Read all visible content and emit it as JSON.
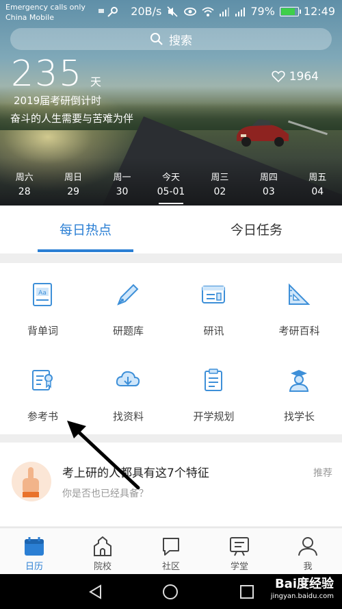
{
  "status_bar": {
    "carrier_line1": "Emergency calls only",
    "carrier_line2": "China Mobile",
    "speed": "20B/s",
    "battery": "79%",
    "battery_level": 0.79,
    "time": "12:49"
  },
  "search": {
    "label": "搜索"
  },
  "countdown": {
    "days": "235",
    "unit": "天",
    "likes": "1964",
    "subtitle": "2019届考研倒计时",
    "motto": "奋斗的人生需要与苦难为伴"
  },
  "week": [
    {
      "dow": "周六",
      "date": "28"
    },
    {
      "dow": "周日",
      "date": "29"
    },
    {
      "dow": "周一",
      "date": "30"
    },
    {
      "dow": "今天",
      "date": "05-01"
    },
    {
      "dow": "周三",
      "date": "02"
    },
    {
      "dow": "周四",
      "date": "03"
    },
    {
      "dow": "周五",
      "date": "04"
    }
  ],
  "tabs": [
    {
      "label": "每日热点"
    },
    {
      "label": "今日任务"
    }
  ],
  "grid": [
    {
      "label": "背单词",
      "icon": "dictionary-icon"
    },
    {
      "label": "研题库",
      "icon": "pen-icon"
    },
    {
      "label": "研讯",
      "icon": "news-icon"
    },
    {
      "label": "考研百科",
      "icon": "ruler-icon"
    },
    {
      "label": "参考书",
      "icon": "certificate-icon"
    },
    {
      "label": "找资料",
      "icon": "cloud-download-icon"
    },
    {
      "label": "开学规划",
      "icon": "clipboard-icon"
    },
    {
      "label": "找学长",
      "icon": "graduate-icon"
    }
  ],
  "article": {
    "title": "考上研的人都具有这7个特征",
    "subtitle": "你是否也已经具备？",
    "tag": "推荐"
  },
  "bottom_nav": [
    {
      "label": "日历",
      "icon": "calendar-icon"
    },
    {
      "label": "院校",
      "icon": "school-icon"
    },
    {
      "label": "社区",
      "icon": "chat-icon"
    },
    {
      "label": "学堂",
      "icon": "classroom-icon"
    },
    {
      "label": "我",
      "icon": "profile-icon"
    }
  ],
  "watermark": {
    "main": "Bai度经验",
    "sub": "jingyan.baidu.com"
  },
  "colors": {
    "accent": "#2b7fd4"
  }
}
